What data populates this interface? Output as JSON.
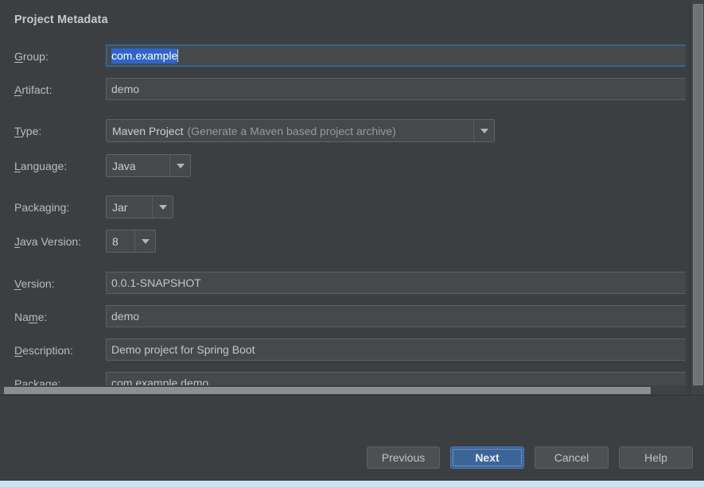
{
  "dialog": {
    "section_title": "Project Metadata"
  },
  "fields": {
    "group": {
      "label_pre": "",
      "label_mnemonic": "G",
      "label_post": "roup:",
      "value": "com.example",
      "selected": true,
      "focused": true
    },
    "artifact": {
      "label_pre": "",
      "label_mnemonic": "A",
      "label_post": "rtifact:",
      "value": "demo"
    },
    "type": {
      "label_pre": "",
      "label_mnemonic": "T",
      "label_post": "ype:",
      "value": "Maven Project",
      "value_detail": "(Generate a Maven based project archive)",
      "arrow_icon": "chevron-down-icon"
    },
    "language": {
      "label_pre": "",
      "label_mnemonic": "L",
      "label_post": "anguage:",
      "value": "Java",
      "arrow_icon": "chevron-down-icon"
    },
    "packaging": {
      "label_pre": "",
      "label_mnemonic": "",
      "label_post": "Packaging:",
      "value": "Jar",
      "arrow_icon": "chevron-down-icon"
    },
    "java_version": {
      "label_pre": "",
      "label_mnemonic": "J",
      "label_post": "ava Version:",
      "value": "8",
      "arrow_icon": "chevron-down-icon"
    },
    "version": {
      "label_pre": "",
      "label_mnemonic": "V",
      "label_post": "ersion:",
      "value": "0.0.1-SNAPSHOT"
    },
    "name": {
      "label_pre": "Na",
      "label_mnemonic": "m",
      "label_post": "e:",
      "value": "demo"
    },
    "description": {
      "label_pre": "",
      "label_mnemonic": "D",
      "label_post": "escription:",
      "value": "Demo project for Spring Boot"
    },
    "package": {
      "label_pre": "Pac",
      "label_mnemonic": "k",
      "label_post": "age:",
      "value": "com.example.demo"
    }
  },
  "buttons": {
    "previous": "Previous",
    "next": "Next",
    "cancel": "Cancel",
    "help": "Help"
  },
  "scrollbars": {
    "vertical_name": "vertical-scrollbar",
    "horizontal_name": "horizontal-scrollbar"
  },
  "colors": {
    "background": "#3c3f41",
    "field_background": "#45494a",
    "field_border": "#5e6060",
    "focus_border": "#3d6185",
    "selection": "#2f65ca",
    "primary_button": "#3c6498",
    "text": "#bbbbbb",
    "text_dim": "#9a9a9a"
  }
}
